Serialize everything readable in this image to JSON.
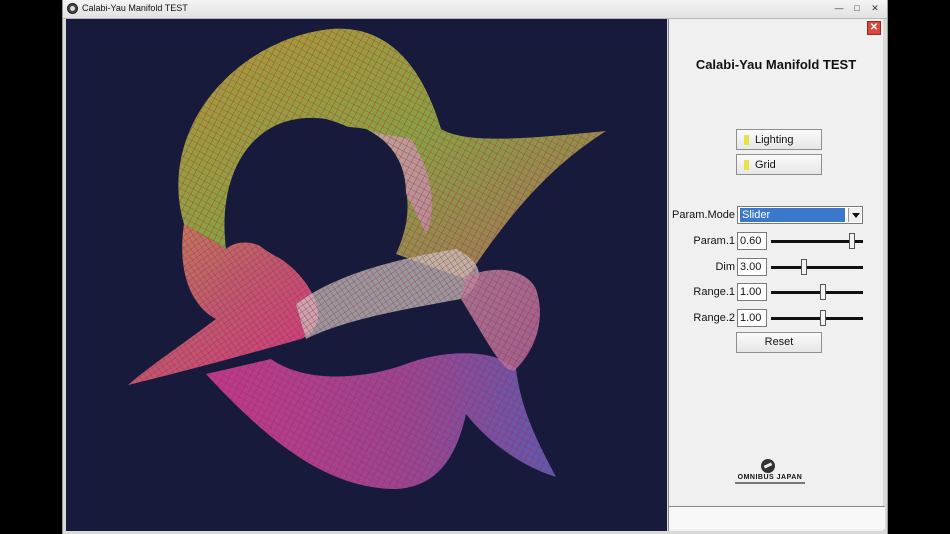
{
  "window": {
    "title": "Calabi-Yau Manifold TEST",
    "controls": [
      "—",
      "□",
      "✕"
    ]
  },
  "panel": {
    "title": "Calabi-Yau Manifold TEST",
    "close_icon": "✕",
    "lighting_label": "Lighting",
    "grid_label": "Grid",
    "param_mode": {
      "label": "Param.Mode",
      "selected": "Slider"
    },
    "params": [
      {
        "label": "Param.1",
        "value": "0.60",
        "level": 0.88
      },
      {
        "label": "Dim",
        "value": "3.00",
        "level": 0.36
      },
      {
        "label": "Range.1",
        "value": "1.00",
        "level": 0.56
      },
      {
        "label": "Range.2",
        "value": "1.00",
        "level": 0.56
      }
    ],
    "reset_label": "Reset",
    "logo": {
      "name": "OMNIBUS JAPAN"
    }
  },
  "colors": {
    "viewport_bg": "#171a3b",
    "mesh_line": "#b4193c",
    "led": "#e8e24a",
    "selection": "#3a78cc"
  }
}
